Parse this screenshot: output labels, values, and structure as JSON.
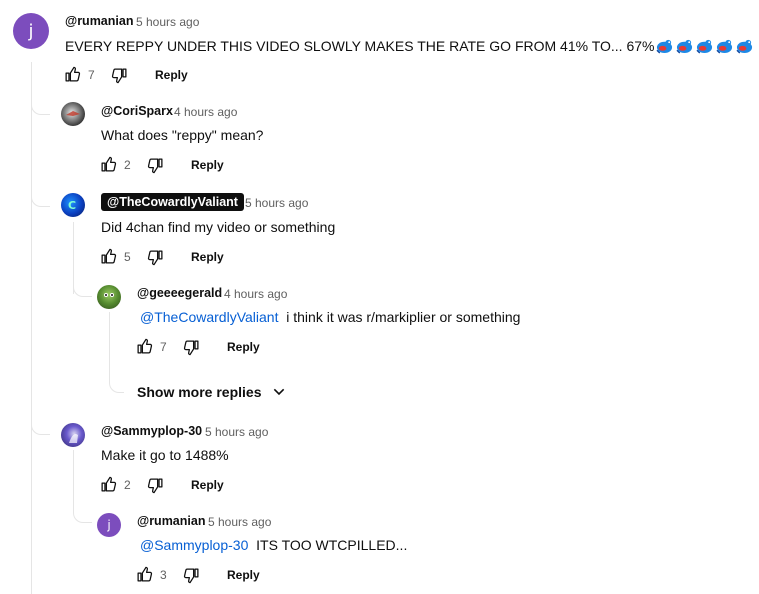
{
  "colors": {
    "mention": "#065fd4",
    "avatar_j": "#7c4dbd",
    "secondary_text": "#606060"
  },
  "comments": [
    {
      "author": "@rumanian",
      "time": "5 hours ago",
      "text": "EVERY REPPY UNDER THIS VIDEO SLOWLY MAKES THE RATE GO FROM 41% TO... 67%",
      "likes": "7",
      "reply_label": "Reply",
      "avatar_letter": "j"
    },
    {
      "author": "@CoriSparx",
      "time": "4 hours ago",
      "text": "What does \"reppy\" mean?",
      "likes": "2",
      "reply_label": "Reply"
    },
    {
      "author": "@TheCowardlyValiant",
      "time": "5 hours ago",
      "text": "Did 4chan find my video or something",
      "likes": "5",
      "reply_label": "Reply"
    },
    {
      "author": "@geeeegerald",
      "time": "4 hours ago",
      "mention": "@TheCowardlyValiant",
      "text": "i think it was r/markiplier or something",
      "likes": "7",
      "reply_label": "Reply"
    },
    {
      "author": "@Sammyplop-30",
      "time": "5 hours ago",
      "text": "Make it go to 1488%",
      "likes": "2",
      "reply_label": "Reply"
    },
    {
      "author": "@rumanian",
      "time": "5 hours ago",
      "mention": "@Sammyplop-30",
      "text": "ITS TOO WTCPILLED...",
      "likes": "3",
      "reply_label": "Reply",
      "avatar_letter": "j"
    }
  ],
  "show_more": {
    "label": "Show more replies"
  },
  "icons": {
    "like": "thumbs-up-icon",
    "dislike": "thumbs-down-icon",
    "expand": "chevron-down-icon",
    "emoji": "blue-bird-emoji"
  }
}
